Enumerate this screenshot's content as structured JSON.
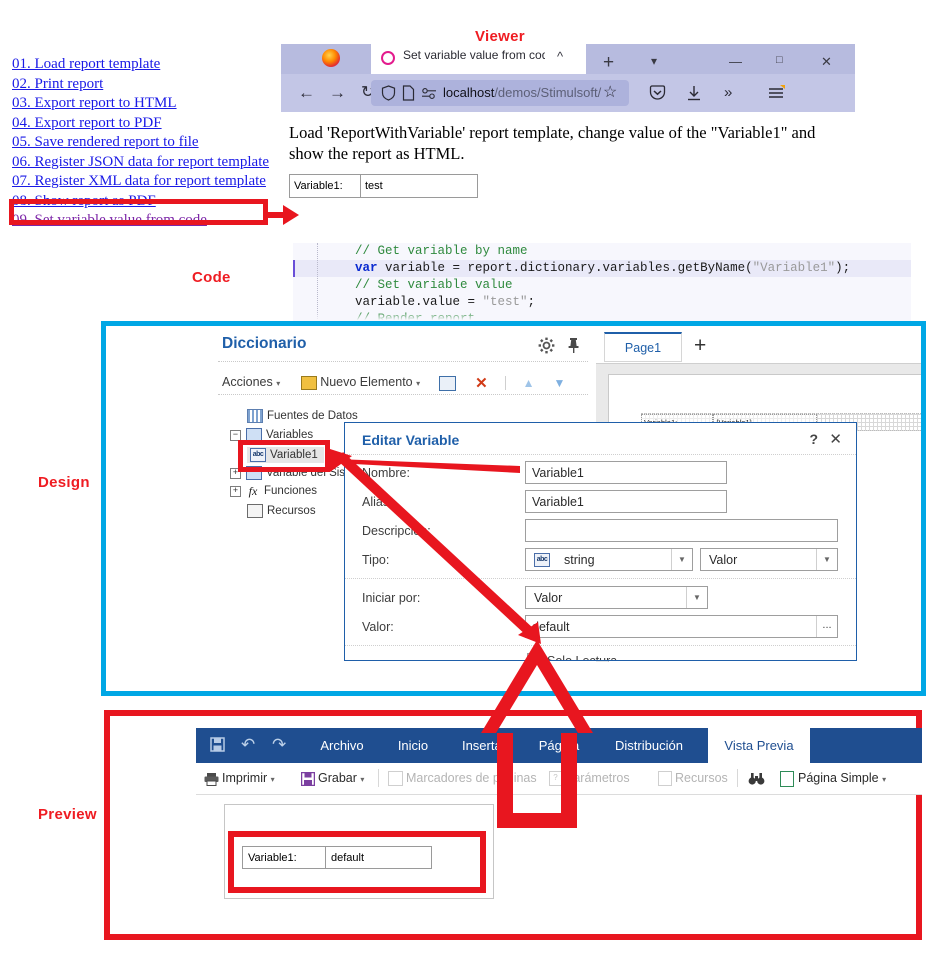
{
  "sections": {
    "viewer_label": "Viewer",
    "code_label": "Code",
    "design_label": "Design",
    "preview_label": "Preview"
  },
  "demo_links": [
    {
      "text": "01. Load report template",
      "visited": false
    },
    {
      "text": "02. Print report",
      "visited": false
    },
    {
      "text": "03. Export report to HTML",
      "visited": false
    },
    {
      "text": "04. Export report to PDF",
      "visited": false
    },
    {
      "text": "05. Save rendered report to file",
      "visited": false
    },
    {
      "text": "06. Register JSON data for report template",
      "visited": false
    },
    {
      "text": "07. Register XML data for report template",
      "visited": false
    },
    {
      "text": "08. Show report as PDF",
      "visited": false
    },
    {
      "text": "09. Set variable value from code",
      "visited": true
    }
  ],
  "browser": {
    "tab_title": "Set variable value from code",
    "tab_collapse_icon": "chevron-up-icon",
    "new_tab_icon": "plus-icon",
    "tab_list_icon": "chevron-down-icon",
    "minimize_icon": "minimize-icon",
    "maximize_icon": "maximize-icon",
    "close_icon": "close-icon",
    "back_icon": "arrow-left-icon",
    "forward_icon": "arrow-right-icon",
    "reload_icon": "reload-icon",
    "shield_icon": "shield-icon",
    "page_icon": "page-icon",
    "permissions_icon": "permissions-icon",
    "bookmark_icon": "star-icon",
    "pocket_icon": "pocket-icon",
    "downloads_icon": "download-icon",
    "overflow_icon": "chevrons-right-icon",
    "menu_icon": "hamburger-menu-icon",
    "url_host": "localhost",
    "url_path": "/demos/Stimulsoft/",
    "page_text": "Load 'ReportWithVariable' report template, change value of the \"Variable1\" and show the report as HTML.",
    "report_table": {
      "label": "Variable1:",
      "value": "test"
    }
  },
  "code": {
    "lines": [
      {
        "text": "// Get variable by name",
        "kind": "comment",
        "highlight": false
      },
      {
        "text": "var variable = report.dictionary.variables.getByName(\"Variable1\");",
        "kind": "code",
        "highlight": true
      },
      {
        "text": "// Set variable value",
        "kind": "comment",
        "highlight": false
      },
      {
        "text": "variable.value = \"test\";",
        "kind": "code",
        "highlight": false
      },
      {
        "text": "// Render report",
        "kind": "comment",
        "highlight": false
      }
    ],
    "tokens": {
      "kw_var": "var",
      "expr_mid": " variable = report.dictionary.variables.getByName(",
      "str_variable1": "\"Variable1\"",
      "expr_end": ");",
      "assign_lhs": "variable.value = ",
      "str_test": "\"test\"",
      "assign_end": ";"
    }
  },
  "design": {
    "dictionary": {
      "title": "Diccionario",
      "settings_icon": "gear-icon",
      "pin_icon": "pin-icon",
      "toolbar": {
        "actions": "Acciones",
        "new_element": "Nuevo Elemento",
        "edit_icon": "edit-icon",
        "delete_icon": "delete-x-icon",
        "move_up_icon": "arrow-up-icon",
        "move_down_icon": "arrow-down-icon"
      },
      "tree": [
        {
          "label": "Fuentes de Datos",
          "icon": "grid-icon",
          "expander": "",
          "selected": false,
          "indent": 1
        },
        {
          "label": "Variables",
          "icon": "var-icon",
          "expander": "-",
          "selected": false,
          "indent": 0
        },
        {
          "label": "Variable1",
          "icon": "abc-icon",
          "expander": "",
          "selected": true,
          "indent": 2
        },
        {
          "label": "Variable del Sistema",
          "icon": "sysvar-icon",
          "expander": "+",
          "selected": false,
          "indent": 0
        },
        {
          "label": "Funciones",
          "icon": "fx-icon",
          "expander": "+",
          "selected": false,
          "indent": 0
        },
        {
          "label": "Recursos",
          "icon": "resource-icon",
          "expander": "",
          "selected": false,
          "indent": 1
        }
      ]
    },
    "page_tab": "Page1",
    "add_page_icon": "plus-icon",
    "canvas_cells": [
      {
        "text": "Variable1:"
      },
      {
        "text": "{Variable1}"
      }
    ]
  },
  "dialog": {
    "title": "Editar Variable",
    "help_icon": "question-mark-icon",
    "close_icon": "close-icon",
    "fields": {
      "nombre_label": "Nombre:",
      "nombre_value": "Variable1",
      "alias_label": "Alias:",
      "alias_value": "Variable1",
      "descripcion_label": "Descripción:",
      "descripcion_value": "",
      "tipo_label": "Tipo:",
      "tipo_value": "string",
      "tipo_icon": "abc-icon",
      "tipo_kind_value": "Valor",
      "iniciar_label": "Iniciar por:",
      "iniciar_value": "Valor",
      "valor_label": "Valor:",
      "valor_value": "default",
      "valor_browse": "...",
      "solo_lectura_label": "Solo Lectura"
    }
  },
  "preview": {
    "ribbon": {
      "save_icon": "save-icon",
      "undo_icon": "undo-icon",
      "redo_icon": "redo-icon",
      "tabs": [
        "Archivo",
        "Inicio",
        "Insertar",
        "Página",
        "Distribución",
        "Vista Previa"
      ],
      "active_tab": "Vista Previa"
    },
    "toolbar": [
      {
        "label": "Imprimir",
        "icon": "printer-icon",
        "disabled": false,
        "dropdown": true
      },
      {
        "label": "Grabar",
        "icon": "save-icon",
        "disabled": false,
        "dropdown": true
      },
      {
        "label": "Marcadores de páginas",
        "icon": "bookmarks-icon",
        "disabled": true,
        "dropdown": false
      },
      {
        "label": "Parámetros",
        "icon": "parameters-icon",
        "disabled": true,
        "dropdown": false
      },
      {
        "label": "Recursos",
        "icon": "resource-icon",
        "disabled": true,
        "dropdown": false
      },
      {
        "label": "",
        "icon": "find-binoculars-icon",
        "disabled": false,
        "dropdown": false
      },
      {
        "label": "Página Simple",
        "icon": "single-page-icon",
        "disabled": false,
        "dropdown": true
      }
    ],
    "report_table": {
      "label": "Variable1:",
      "value": "default"
    }
  },
  "colors": {
    "design_outline": "#00a7e5",
    "preview_outline": "#e8161f",
    "annotation_red": "#e8161f",
    "ribbon_blue": "#1f4e90",
    "link_blue": "#1a1ae6",
    "link_visited": "#7d26a8"
  }
}
